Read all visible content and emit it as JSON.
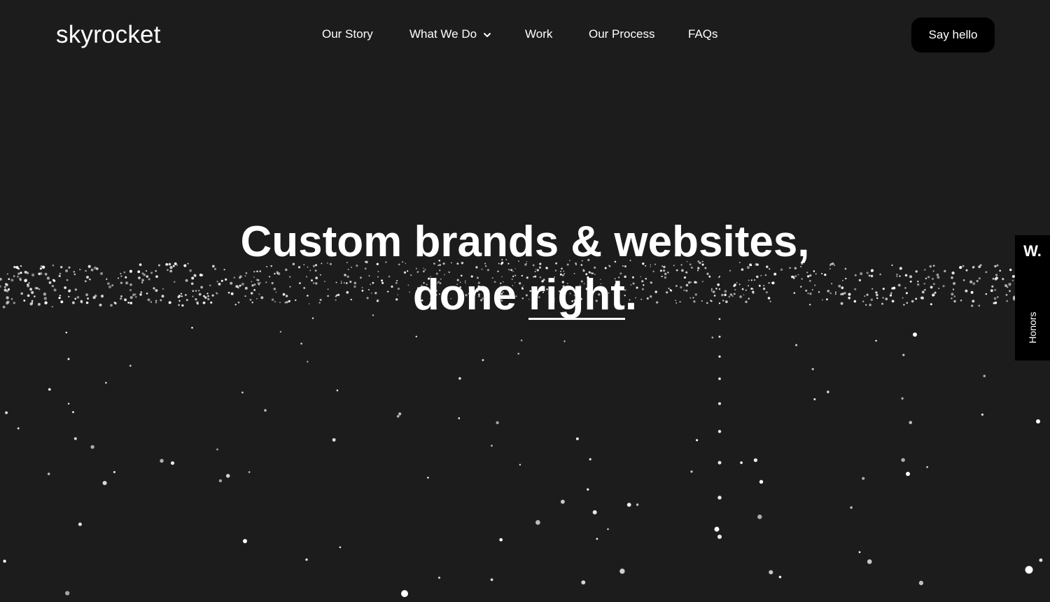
{
  "brand": {
    "logo_text": "skyrocket"
  },
  "nav": {
    "items": [
      {
        "label": "Our Story"
      },
      {
        "label": "What We Do"
      },
      {
        "label": "Work"
      },
      {
        "label": "Our Process"
      },
      {
        "label": "FAQs"
      }
    ],
    "cta_label": "Say hello"
  },
  "hero": {
    "line1": "Custom brands & websites,",
    "line2_prefix": "done",
    "line2_emphasis": "right",
    "line2_suffix": "."
  },
  "honors_tab": {
    "mark": "W.",
    "label": "Honors"
  },
  "colors": {
    "background": "#1c1c1c",
    "text": "#ffffff",
    "button_bg": "#000000"
  },
  "icons": {
    "dropdown": "chevron-down-icon"
  }
}
